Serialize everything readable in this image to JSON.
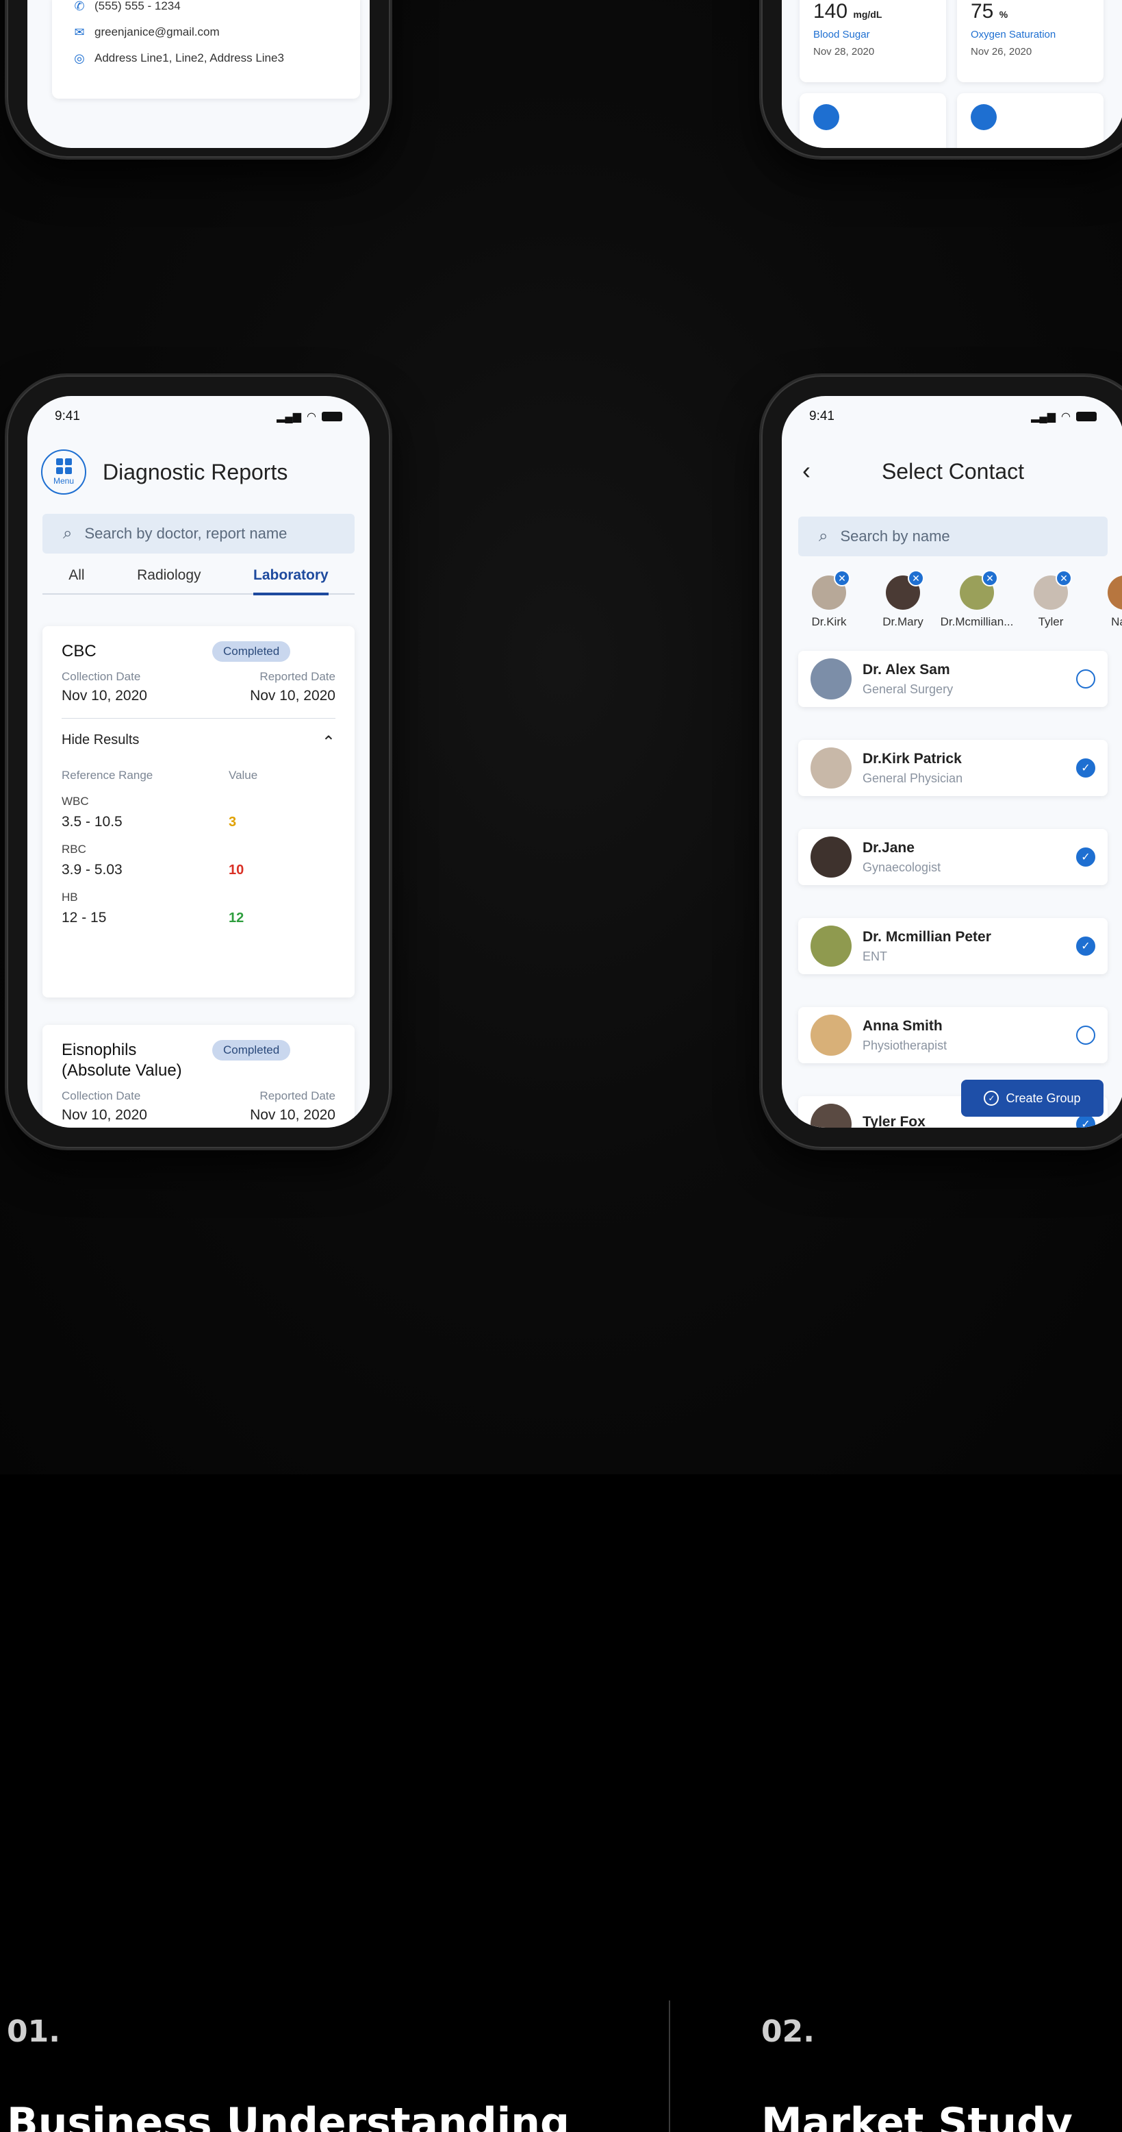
{
  "profile_fragment": {
    "phone": "(555) 555 - 1234",
    "email": "greenjanice@gmail.com",
    "address": "Address Line1, Line2, Address Line3"
  },
  "vitals_fragment": {
    "items": [
      {
        "value": "140",
        "unit": "mg/dL",
        "label": "Blood Sugar",
        "date": "Nov 28, 2020"
      },
      {
        "value": "75",
        "unit": "%",
        "label": "Oxygen Saturation",
        "date": "Nov 26, 2020"
      }
    ]
  },
  "diagnostic": {
    "time": "9:41",
    "menu_label": "Menu",
    "title": "Diagnostic Reports",
    "search_placeholder": "Search by doctor, report name",
    "tabs": [
      "All",
      "Radiology",
      "Laboratory"
    ],
    "reports": [
      {
        "name": "CBC",
        "status": "Completed",
        "collection_label": "Collection Date",
        "collection_date": "Nov 10, 2020",
        "reported_label": "Reported Date",
        "reported_date": "Nov 10, 2020",
        "toggle": "Hide Results",
        "range_header": "Reference Range",
        "value_header": "Value",
        "results": [
          {
            "name": "WBC",
            "range": "3.5 - 10.5",
            "value": "3",
            "color": "#e0a100"
          },
          {
            "name": "RBC",
            "range": "3.9 - 5.03",
            "value": "10",
            "color": "#d93025"
          },
          {
            "name": "HB",
            "range": "12 - 15",
            "value": "12",
            "color": "#2e9e3e"
          }
        ]
      },
      {
        "name": "Eisnophils (Absolute Value)",
        "status": "Completed",
        "collection_label": "Collection Date",
        "collection_date": "Nov 10, 2020",
        "reported_label": "Reported Date",
        "reported_date": "Nov 10, 2020"
      }
    ]
  },
  "contacts": {
    "time": "9:41",
    "title": "Select Contact",
    "search_placeholder": "Search by name",
    "selected": [
      "Dr.Kirk",
      "Dr.Mary",
      "Dr.Mcmillian...",
      "Tyler",
      "Nanc"
    ],
    "list": [
      {
        "name": "Dr. Alex Sam",
        "role": "General Surgery",
        "selected": false
      },
      {
        "name": "Dr.Kirk Patrick",
        "role": "General Physician",
        "selected": true
      },
      {
        "name": "Dr.Jane",
        "role": "Gynaecologist",
        "selected": true
      },
      {
        "name": "Dr. Mcmillian Peter",
        "role": "ENT",
        "selected": true
      },
      {
        "name": "Anna Smith",
        "role": "Physiotherapist",
        "selected": false
      },
      {
        "name": "Tyler Fox",
        "role": "",
        "selected": true
      }
    ],
    "create_button": "Create Group"
  },
  "sections": [
    {
      "number": "01.",
      "title": "Business Understanding"
    },
    {
      "number": "02.",
      "title": "Market Study"
    }
  ]
}
